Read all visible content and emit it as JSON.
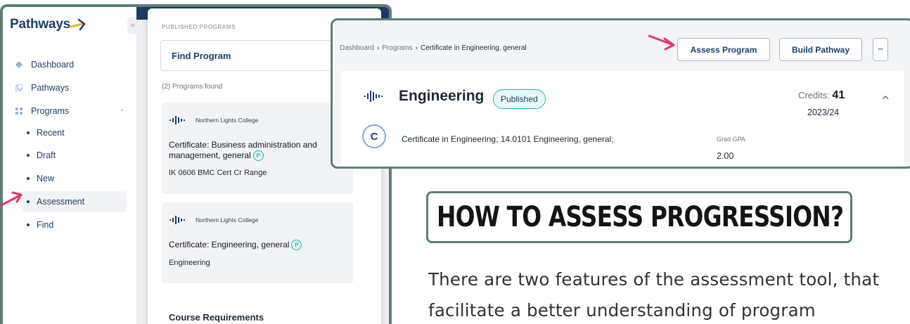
{
  "sidebar": {
    "logo": "Pathways",
    "items": [
      {
        "label": "Dashboard"
      },
      {
        "label": "Pathways"
      },
      {
        "label": "Programs"
      }
    ],
    "sub_items": [
      {
        "label": "Recent"
      },
      {
        "label": "Draft"
      },
      {
        "label": "New"
      },
      {
        "label": "Assessment"
      },
      {
        "label": "Find"
      }
    ]
  },
  "panel": {
    "header": "PUBLISHED PROGRAMS",
    "find_label": "Find Program",
    "found_text": "(2) Programs found",
    "programs": [
      {
        "school": "Northern Lights College",
        "title_line1": "Certificate: Business administration and",
        "title_line2": "management, general",
        "badge": "P",
        "code": "IK 0606 BMC Cert Cr Range"
      },
      {
        "school": "Northern Lights College",
        "title_line1": "Certificate: Engineering, general",
        "badge": "P",
        "code": "Engineering"
      }
    ],
    "course_requirements": "Course Requirements"
  },
  "detail": {
    "breadcrumb": [
      "Dashboard",
      "Programs",
      "Certificate in Engineering, general"
    ],
    "buttons": {
      "assess": "Assess Program",
      "build": "Build Pathway",
      "more": "···"
    },
    "title": "Engineering",
    "status": "Published",
    "credits_label": "Credits:",
    "credits_value": "41",
    "year": "2023/24",
    "avatar": "C",
    "description": "Certificate in Engineering; 14.0101 Engineering, general;",
    "gpa_label": "Grad GPA",
    "gpa_value": "2.00"
  },
  "content": {
    "heading": "HOW TO ASSESS PROGRESSION?",
    "body_line1": "There are two features of the assessment tool, that",
    "body_line2": "facilitate a better understanding of program"
  },
  "colors": {
    "frame": "#5d7f77",
    "navy": "#1e3f6b",
    "teal": "#16b3b3",
    "arrow": "#e8336d"
  },
  "icons": {
    "pointer": "arrow-pointer-icon",
    "wave": "soundwave-logo-icon",
    "collapse": "chevron-up-icon"
  }
}
